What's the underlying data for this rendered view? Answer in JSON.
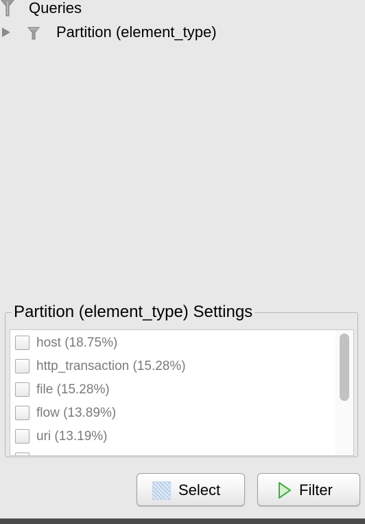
{
  "tree": {
    "root_label": "Queries",
    "root_icon": "funnel-icon",
    "child": {
      "label": "Partition (element_type)",
      "icon": "funnel-icon",
      "expanded": false
    }
  },
  "settings": {
    "title": "Partition (element_type) Settings",
    "items": [
      {
        "label": "host (18.75%)",
        "checked": false
      },
      {
        "label": "http_transaction (15.28%)",
        "checked": false
      },
      {
        "label": "file (15.28%)",
        "checked": false
      },
      {
        "label": "flow (13.89%)",
        "checked": false
      },
      {
        "label": "uri (13.19%)",
        "checked": false
      }
    ]
  },
  "buttons": {
    "select_label": "Select",
    "filter_label": "Filter"
  },
  "colors": {
    "background": "#e8e8e8",
    "item_text": "#7a7a7a",
    "filter_arrow": "#3fae3f"
  }
}
